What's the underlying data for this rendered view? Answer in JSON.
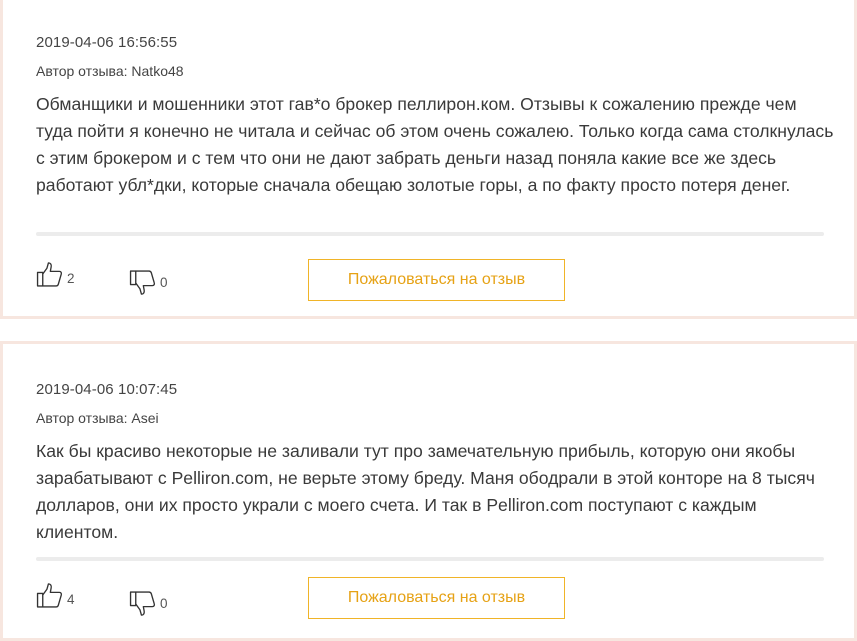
{
  "reviews": [
    {
      "date": "2019-04-06 16:56:55",
      "author": "Автор отзыва: Natko48",
      "text": "Обманщики и мошенники этот гав*о брокер пеллирон.ком. Отзывы к сожалению прежде чем туда пойти я конечно не читала и сейчас об этом очень сожалею. Только когда сама столкнулась с этим брокером и с тем что они не дают забрать деньги назад поняла какие все же здесь работают убл*дки, которые сначала обещаю золотые горы, а по факту просто потеря денег.",
      "likes": "2",
      "dislikes": "0",
      "report_label": "Пожаловаться на отзыв"
    },
    {
      "date": "2019-04-06 10:07:45",
      "author": "Автор отзыва: Asei",
      "text": "Как бы красиво некоторые не заливали тут про замечательную прибыль, которую они якобы зарабатывают с Pelliron.com, не верьте этому бреду. Маня ободрали в этой конторе на 8 тысяч долларов, они их просто украли с моего счета. И так в Pelliron.com поступают с каждым клиентом.",
      "likes": "4",
      "dislikes": "0",
      "report_label": "Пожаловаться на отзыв"
    }
  ],
  "icons": {
    "like": "thumbs-up-icon",
    "dislike": "thumbs-down-icon"
  },
  "colors": {
    "accent": "#f0b428",
    "card_border": "#f7e6df",
    "divider": "#ececec"
  }
}
